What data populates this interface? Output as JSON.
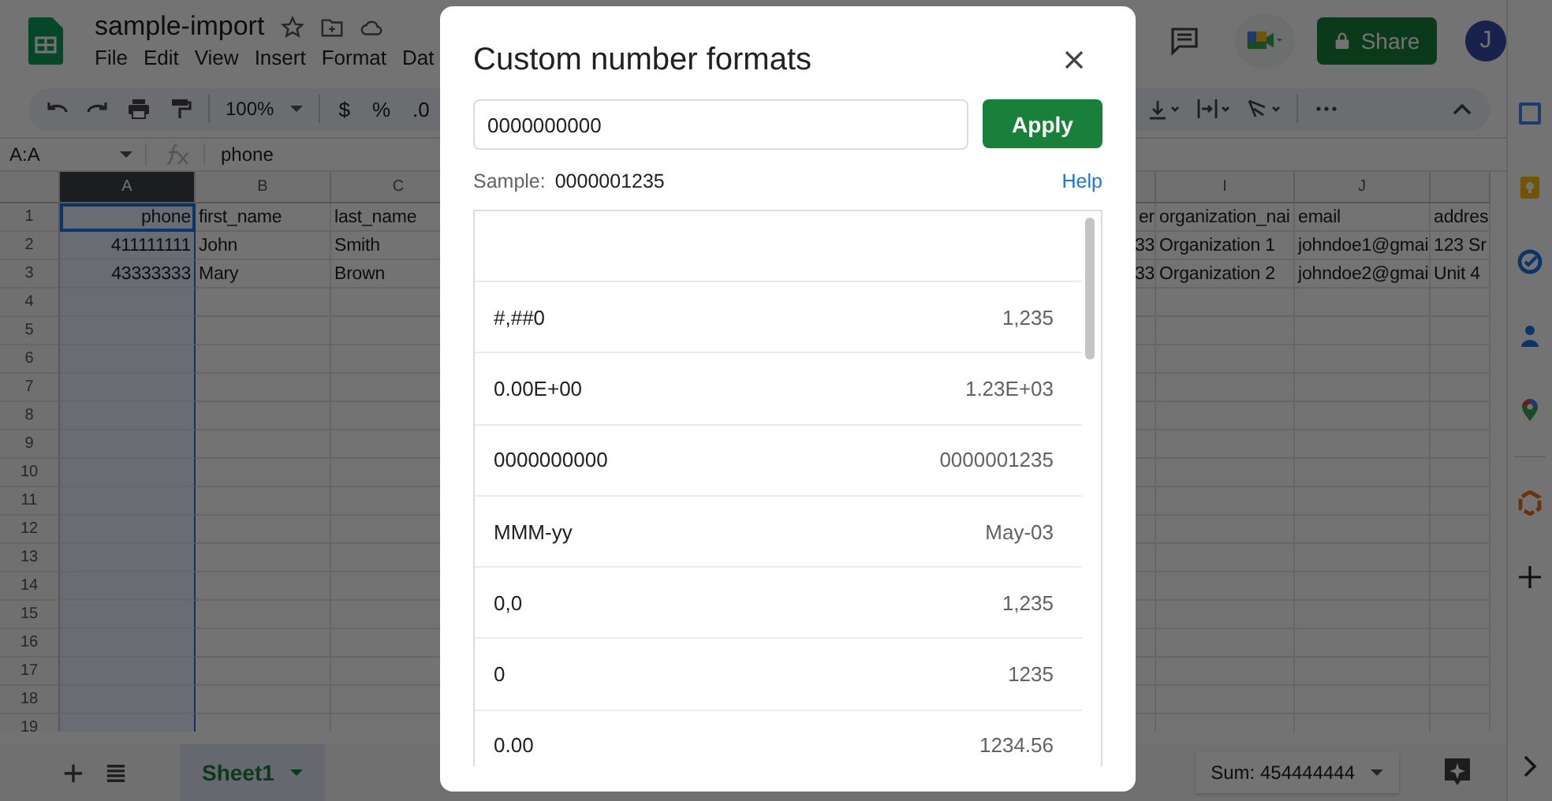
{
  "app": {
    "title": "sample-import",
    "menu": [
      "File",
      "Edit",
      "View",
      "Insert",
      "Format",
      "Dat"
    ],
    "share_label": "Share",
    "avatar": "J"
  },
  "toolbar": {
    "zoom": "100%",
    "currency": "$",
    "percent": "%",
    "decimal": ".0"
  },
  "formula_bar": {
    "name_box": "A:A",
    "formula": "phone"
  },
  "grid": {
    "columns": [
      {
        "label": "A",
        "selected": true
      },
      {
        "label": "B",
        "selected": false
      },
      {
        "label": "C",
        "selected": false
      },
      {
        "label": "I",
        "selected": false
      },
      {
        "label": "J",
        "selected": false
      }
    ],
    "rows": [
      {
        "number": "1",
        "cells": [
          "phone",
          "first_name",
          "last_name",
          "er",
          "organization_nai",
          "email",
          "addres"
        ]
      },
      {
        "number": "2",
        "cells": [
          "411111111",
          "John",
          "Smith",
          "33",
          "Organization 1",
          "johndoe1@gmai",
          "123 Sr"
        ]
      },
      {
        "number": "3",
        "cells": [
          "43333333",
          "Mary",
          "Brown",
          "33",
          "Organization 2",
          "johndoe2@gmai",
          "Unit 4"
        ]
      },
      {
        "number": "4"
      },
      {
        "number": "5"
      },
      {
        "number": "6"
      },
      {
        "number": "7"
      },
      {
        "number": "8"
      },
      {
        "number": "9"
      },
      {
        "number": "10"
      },
      {
        "number": "11"
      },
      {
        "number": "12"
      },
      {
        "number": "13"
      },
      {
        "number": "14"
      },
      {
        "number": "15"
      },
      {
        "number": "16"
      },
      {
        "number": "17"
      },
      {
        "number": "18"
      },
      {
        "number": "19"
      }
    ]
  },
  "sheet_tabs": [
    {
      "label": "Sheet1",
      "selected": true
    }
  ],
  "status_bar": {
    "sum": "Sum: 454444444"
  },
  "dialog": {
    "title": "Custom number formats",
    "input": {
      "value": "0000000000"
    },
    "apply_label": "Apply",
    "sample_label": "Sample:",
    "sample_value": "0000001235",
    "help_link": "Help",
    "formats": [
      {
        "pattern": "#,##0",
        "preview": "1,235"
      },
      {
        "pattern": "0.00E+00",
        "preview": "1.23E+03"
      },
      {
        "pattern": "0000000000",
        "preview": "0000001235"
      },
      {
        "pattern": "MMM-yy",
        "preview": "May-03"
      },
      {
        "pattern": "0,0",
        "preview": "1,235"
      },
      {
        "pattern": "0",
        "preview": "1235"
      },
      {
        "pattern": "0.00",
        "preview": "1234.56"
      }
    ]
  }
}
